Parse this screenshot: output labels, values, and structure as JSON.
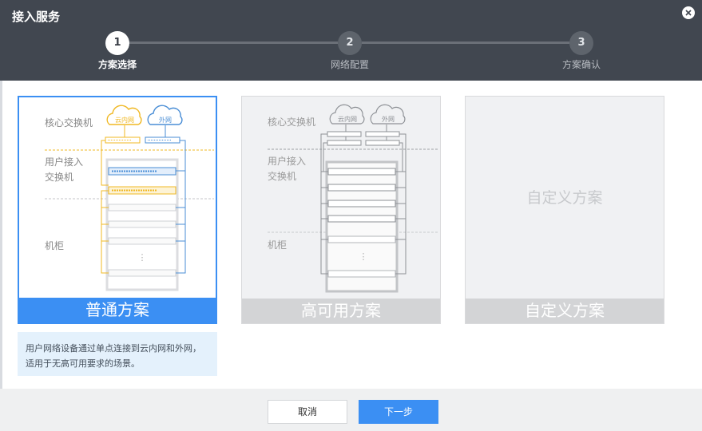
{
  "dialog": {
    "title": "接入服务"
  },
  "steps": [
    {
      "num": "1",
      "label": "方案选择"
    },
    {
      "num": "2",
      "label": "网络配置"
    },
    {
      "num": "3",
      "label": "方案确认"
    }
  ],
  "plans": [
    {
      "label": "普通方案",
      "diagram": {
        "core_label": "核心交换机",
        "access_label_1": "用户接入",
        "access_label_2": "交换机",
        "rack_label": "机柜",
        "cloud_internal": "云内网",
        "cloud_external": "外网"
      }
    },
    {
      "label": "高可用方案",
      "diagram": {
        "core_label": "核心交换机",
        "access_label_1": "用户接入",
        "access_label_2": "交换机",
        "rack_label": "机柜",
        "cloud_internal": "云内网",
        "cloud_external": "外网"
      }
    },
    {
      "label": "自定义方案",
      "title": "自定义方案"
    }
  ],
  "description": "用户网络设备通过单点连接到云内网和外网，适用于无高可用要求的场景。",
  "buttons": {
    "cancel": "取消",
    "next": "下一步"
  },
  "colors": {
    "accent": "#3b8ff3",
    "header": "#414750",
    "internal_cloud": "#f0b823",
    "external_cloud": "#4a8ed6"
  }
}
